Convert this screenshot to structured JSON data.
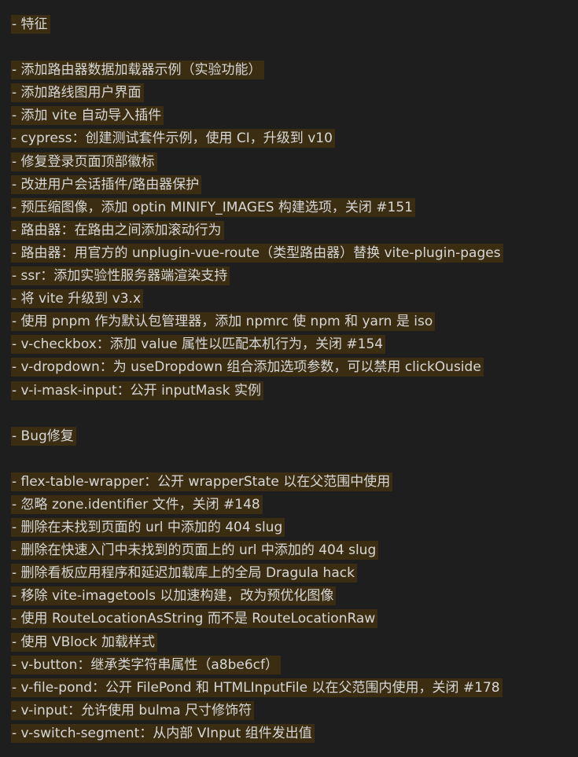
{
  "features": {
    "heading": "- 特征",
    "items": [
      "- 添加路由器数据加载器示例（实验功能）",
      "- 添加路线图用户界面",
      "- 添加 vite 自动导入插件",
      "- cypress：创建测试套件示例，使用 CI，升级到 v10",
      "- 修复登录页面顶部徽标",
      "- 改进用户会话插件/路由器保护",
      "- 预压缩图像，添加 optin MINIFY_IMAGES 构建选项，关闭 #151",
      "- 路由器：在路由之间添加滚动行为",
      "- 路由器：用官方的 unplugin-vue-route（类型路由器）替换 vite-plugin-pages",
      "- ssr：添加实验性服务器端渲染支持",
      "- 将 vite 升级到 v3.x",
      "- 使用 pnpm 作为默认包管理器，添加 npmrc 使 npm 和 yarn 是 iso",
      "- v-checkbox：添加 value 属性以匹配本机行为，关闭 #154",
      "- v-dropdown：为 useDropdown 组合添加选项参数，可以禁用 clickOuside",
      "- v-i-mask-input：公开 inputMask 实例"
    ]
  },
  "bugfixes": {
    "heading": "- Bug修复",
    "items": [
      "- flex-table-wrapper：公开 wrapperState 以在父范围中使用",
      "- 忽略 zone.identifier 文件，关闭 #148",
      "- 删除在未找到页面的 url 中添加的 404 slug",
      "- 删除在快速入门中未找到的页面上的 url 中添加的 404 slug",
      "- 删除看板应用程序和延迟加载库上的全局 Dragula hack",
      "- 移除 vite-imagetools 以加速构建，改为预优化图像",
      "- 使用 RouteLocationAsString 而不是 RouteLocationRaw",
      "- 使用 VBlock 加载样式",
      "- v-button：继承类字符串属性（a8be6cf）",
      "- v-file-pond：公开 FilePond 和 HTMLInputFile 以在父范围内使用，关闭 #178",
      "- v-input：允许使用 bulma 尺寸修饰符",
      "- v-switch-segment：从内部 VInput 组件发出值"
    ]
  },
  "colors": {
    "background": "#1e1e1e",
    "highlight": "#3b2d12",
    "text": "#d4d4d4"
  }
}
